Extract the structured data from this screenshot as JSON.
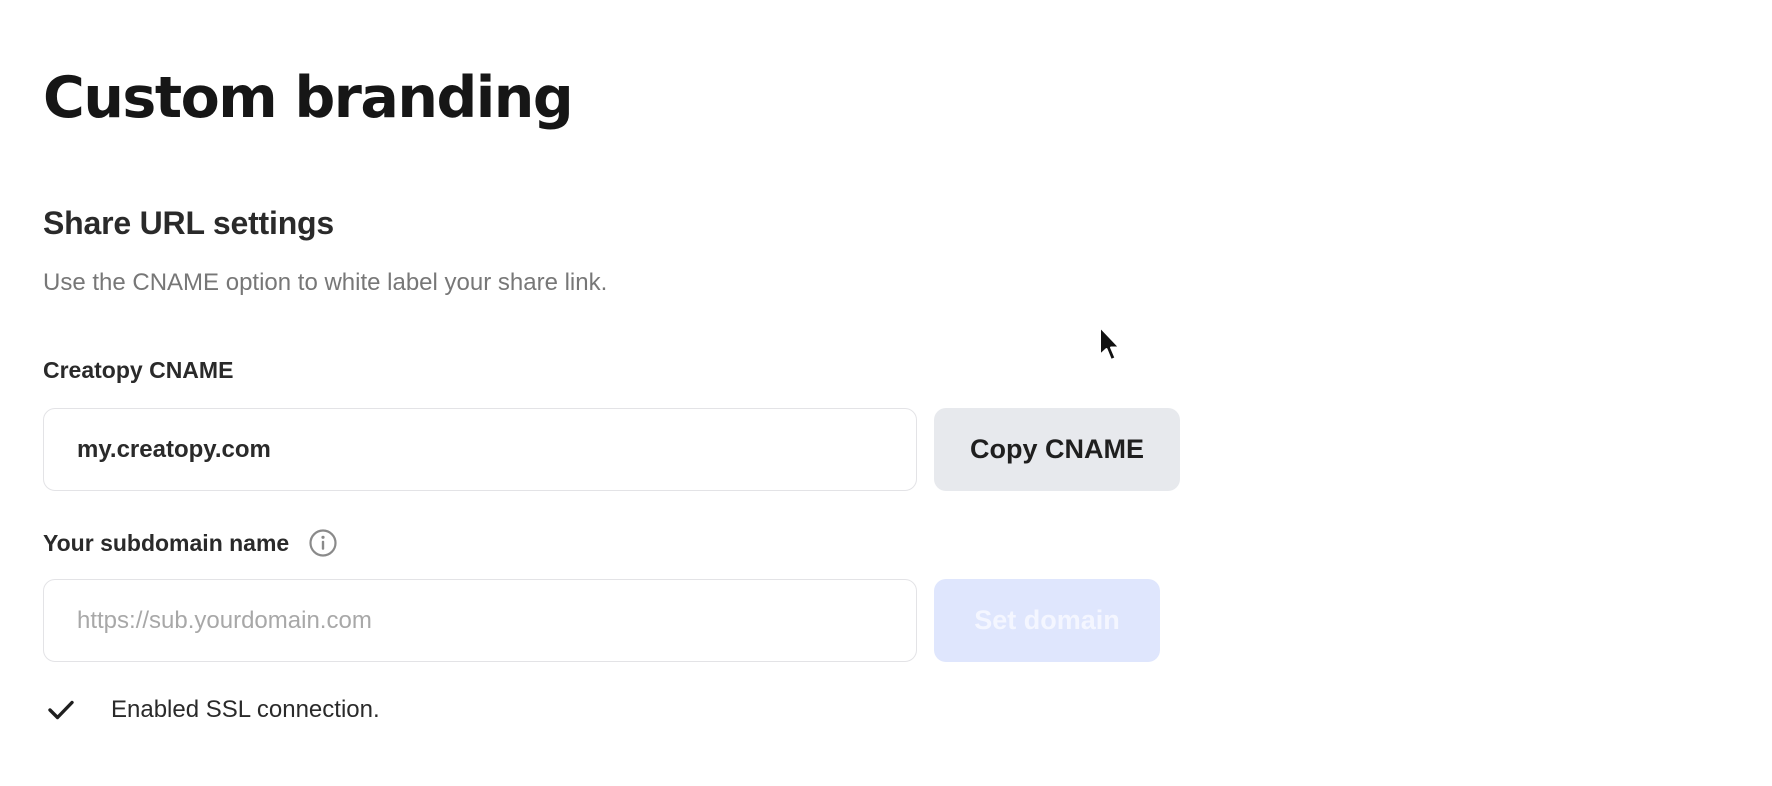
{
  "page": {
    "title": "Custom branding"
  },
  "share_url_settings": {
    "heading": "Share URL settings",
    "description": "Use the CNAME option to white label your share link.",
    "cname": {
      "label": "Creatopy CNAME",
      "value": "my.creatopy.com",
      "copy_button_label": "Copy CNAME"
    },
    "subdomain": {
      "label": "Your subdomain name",
      "info_icon": "info-icon",
      "value": "",
      "placeholder": "https://sub.yourdomain.com",
      "set_button_label": "Set domain"
    },
    "ssl": {
      "icon": "checkmark-icon",
      "text": "Enabled SSL connection."
    }
  },
  "colors": {
    "text_primary": "#161616",
    "text_secondary": "#777777",
    "copy_button_bg": "#e7e9ed",
    "set_button_bg_disabled": "#dfe6fd"
  }
}
